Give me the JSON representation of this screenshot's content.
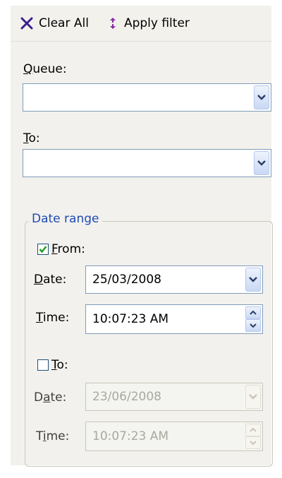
{
  "toolbar": {
    "clear_all": "Clear All",
    "apply_filter": "Apply filter"
  },
  "filters": {
    "queue": {
      "label_key": "Q",
      "label_rest": "ueue:",
      "value": ""
    },
    "to": {
      "label_key": "T",
      "label_rest": "o:",
      "value": ""
    }
  },
  "date_range": {
    "title": "Date range",
    "from": {
      "checked": true,
      "label_key": "F",
      "label_rest": "rom:",
      "date_label_pre": "",
      "date_label_key": "D",
      "date_label_rest": "ate:",
      "date_value": "25/03/2008",
      "time_label_key": "T",
      "time_label_rest": "ime:",
      "time_value": "10:07:23 AM"
    },
    "to": {
      "checked": false,
      "label_key": "T",
      "label_rest": "o:",
      "date_label_pre": "D",
      "date_label_key": "a",
      "date_label_rest": "te:",
      "date_value": "23/06/2008",
      "time_label_pre": "T",
      "time_label_key": "i",
      "time_label_rest": "me:",
      "time_value": "10:07:23 AM",
      "enabled": false
    }
  },
  "colors": {
    "group_title": "#1f4bb5",
    "check": "#21a121",
    "clear_icon": "#3a1e8c",
    "apply_icon": "#8a2aa6"
  }
}
